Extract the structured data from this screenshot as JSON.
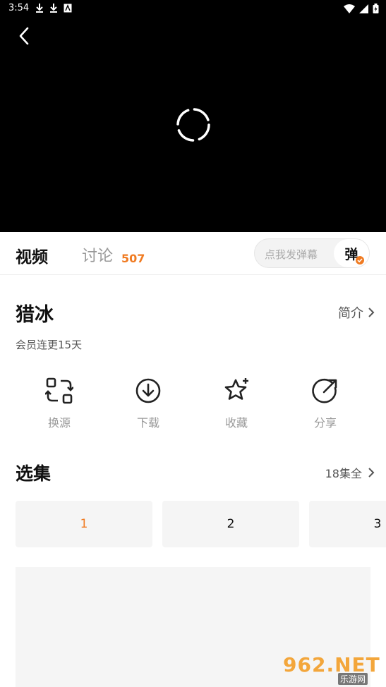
{
  "status_bar": {
    "time": "3:54"
  },
  "player": {},
  "tabs": {
    "video_label": "视频",
    "discuss_label": "讨论",
    "discuss_count": "507"
  },
  "danmaku": {
    "placeholder": "点我发弹幕",
    "toggle_label": "弹"
  },
  "show": {
    "title": "猎冰",
    "intro_label": "简介",
    "subtitle": "会员连更15天"
  },
  "actions": [
    {
      "label": "换源",
      "icon": "switch-source-icon"
    },
    {
      "label": "下载",
      "icon": "download-icon"
    },
    {
      "label": "收藏",
      "icon": "star-icon"
    },
    {
      "label": "分享",
      "icon": "share-icon"
    }
  ],
  "episodes": {
    "section_title": "选集",
    "all_label": "18集全",
    "items": [
      "1",
      "2",
      "3"
    ]
  },
  "watermark": {
    "main": "962.NET",
    "sub": "乐游网"
  },
  "colors": {
    "accent": "#f07b22",
    "player_bg": "#000000"
  }
}
